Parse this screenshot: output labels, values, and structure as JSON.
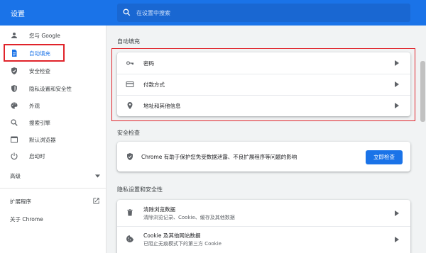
{
  "header": {
    "title": "设置",
    "search_placeholder": "在设置中搜索"
  },
  "sidebar": {
    "items": [
      {
        "label": "您与 Google",
        "icon": "person-icon"
      },
      {
        "label": "自动填充",
        "icon": "autofill-icon",
        "active": true
      },
      {
        "label": "安全检查",
        "icon": "shield-check-icon"
      },
      {
        "label": "隐私设置和安全性",
        "icon": "shield-icon"
      },
      {
        "label": "外观",
        "icon": "palette-icon"
      },
      {
        "label": "搜索引擎",
        "icon": "search-icon"
      },
      {
        "label": "默认浏览器",
        "icon": "browser-icon"
      },
      {
        "label": "启动时",
        "icon": "power-icon"
      }
    ],
    "advanced_label": "高级",
    "extensions_label": "扩展程序",
    "about_label": "关于 Chrome"
  },
  "main": {
    "autofill": {
      "title": "自动填充",
      "rows": [
        {
          "label": "密码",
          "icon": "key-icon"
        },
        {
          "label": "付款方式",
          "icon": "credit-card-icon"
        },
        {
          "label": "地址和其他信息",
          "icon": "location-pin-icon"
        }
      ]
    },
    "safety": {
      "title": "安全检查",
      "text": "Chrome 有助于保护您免受数据泄露、不良扩展程序等问题的影响",
      "button_label": "立即检查"
    },
    "privacy": {
      "title": "隐私设置和安全性",
      "rows": [
        {
          "label": "清除浏览数据",
          "sub": "清除浏览记录、Cookie、缓存及其他数据",
          "icon": "trash-icon"
        },
        {
          "label": "Cookie 及其他网站数据",
          "sub": "已阻止无痕模式下的第三方 Cookie",
          "icon": "cookie-icon"
        }
      ]
    }
  },
  "colors": {
    "accent": "#1a73e8",
    "highlight": "#e0232a"
  }
}
